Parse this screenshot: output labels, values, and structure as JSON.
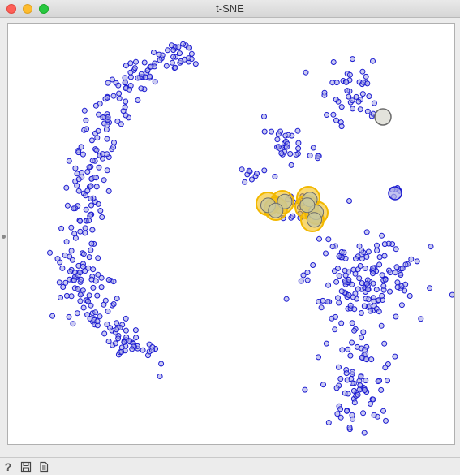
{
  "window": {
    "title": "t-SNE"
  },
  "colors": {
    "point_stroke": "#1a1ad0",
    "point_fill": "#a9a9e8",
    "highlight_ring": "#f2b800",
    "selected_fill": "#c8c8a0",
    "gray_point_fill": "#e0e0d8",
    "gray_point_stroke": "#6b6b6b"
  },
  "icons": {
    "help": "help-icon",
    "save": "save-icon",
    "report": "report-icon"
  }
}
